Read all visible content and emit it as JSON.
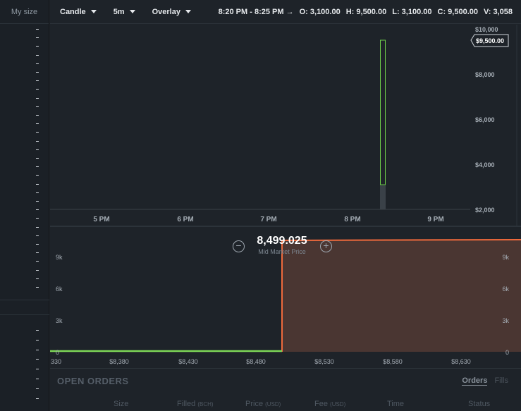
{
  "order_book": {
    "header": "My size"
  },
  "toolbar": {
    "chart_type": "Candle",
    "interval": "5m",
    "overlay": "Overlay",
    "time_range": "8:20 PM - 8:25 PM",
    "arrow": "→",
    "open_label": "O:",
    "open": "3,100.00",
    "high_label": "H:",
    "high": "9,500.00",
    "low_label": "L:",
    "low": "3,100.00",
    "close_label": "C:",
    "close": "9,500.00",
    "volume_label": "V:",
    "volume": "3,058"
  },
  "price_chart": {
    "y_ticks": [
      "$10,000",
      "$8,000",
      "$6,000",
      "$4,000",
      "$2,000"
    ],
    "x_ticks": [
      "5 PM",
      "6 PM",
      "7 PM",
      "8 PM",
      "9 PM"
    ],
    "current_price_tag": "$9,500.00",
    "colors": {
      "up": "#6fcf4a",
      "down": "#f0643c",
      "volume": "#3a4148"
    }
  },
  "depth_chart": {
    "mid_market_price": "8,499.025",
    "mid_market_label": "Mid Market Price",
    "zoom_out_icon": "minus-circle-icon",
    "zoom_in_icon": "plus-circle-icon",
    "y_ticks_left": [
      "9k",
      "6k",
      "3k",
      "0"
    ],
    "y_ticks_right": [
      "9k",
      "6k",
      "3k",
      "0"
    ],
    "x_ticks": [
      "330",
      "$8,380",
      "$8,430",
      "$8,480",
      "$8,530",
      "$8,580",
      "$8,630"
    ],
    "colors": {
      "bid": "#7ed957",
      "ask": "#f06a3c",
      "ask_fill": "#4a3632"
    }
  },
  "open_orders": {
    "title": "OPEN ORDERS",
    "tabs": [
      "Orders",
      "Fills"
    ],
    "columns": [
      {
        "label": "Size",
        "unit": ""
      },
      {
        "label": "Filled",
        "unit": "(BCH)"
      },
      {
        "label": "Price",
        "unit": "(USD)"
      },
      {
        "label": "Fee",
        "unit": "(USD)"
      },
      {
        "label": "Time",
        "unit": ""
      },
      {
        "label": "Status",
        "unit": ""
      }
    ]
  }
}
